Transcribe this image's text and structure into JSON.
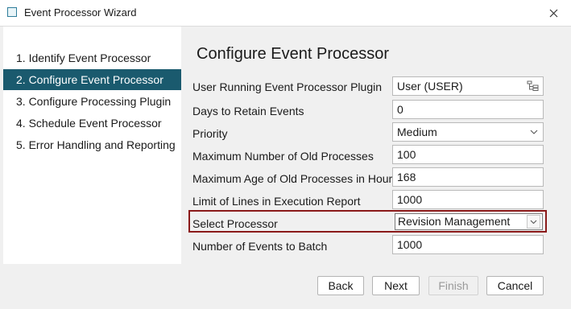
{
  "window": {
    "title": "Event Processor Wizard"
  },
  "steps": [
    {
      "label": "1. Identify Event Processor"
    },
    {
      "label": "2. Configure Event Processor"
    },
    {
      "label": "3. Configure Processing Plugin"
    },
    {
      "label": "4. Schedule Event Processor"
    },
    {
      "label": "5. Error Handling and Reporting"
    }
  ],
  "active_step": 2,
  "main": {
    "title": "Configure Event Processor"
  },
  "form": {
    "user_running": {
      "label": "User Running Event Processor Plugin",
      "value": "User (USER)"
    },
    "days_to_retain": {
      "label": "Days to Retain Events",
      "value": "0"
    },
    "priority": {
      "label": "Priority",
      "value": "Medium"
    },
    "max_old_processes": {
      "label": "Maximum Number of Old Processes",
      "value": "100"
    },
    "max_age_hours": {
      "label": "Maximum Age of Old Processes in Hours",
      "value": "168"
    },
    "limit_lines": {
      "label": "Limit of Lines in Execution Report",
      "value": "1000"
    },
    "select_processor": {
      "label": "Select Processor",
      "value": "Revision Management"
    },
    "events_to_batch": {
      "label": "Number of Events to Batch",
      "value": "1000"
    }
  },
  "buttons": {
    "back": "Back",
    "next": "Next",
    "finish": "Finish",
    "cancel": "Cancel"
  },
  "colors": {
    "active_step_bg": "#1a5a6e",
    "highlight_border": "#8b1a1a"
  }
}
